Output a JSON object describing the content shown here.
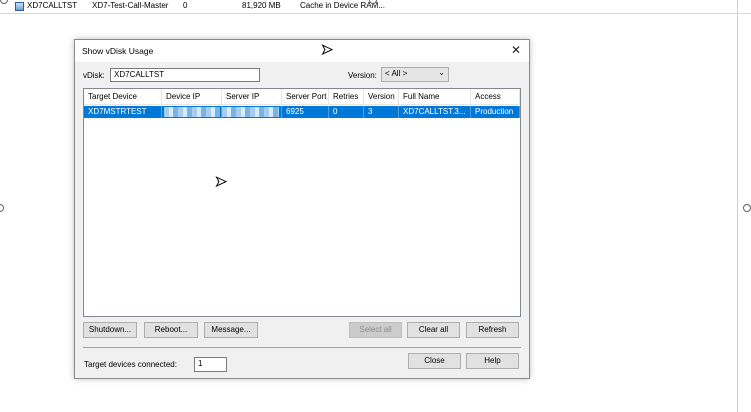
{
  "background_row": {
    "disk_name": "XD7CALLTST",
    "site": "XD7-Test-Call-Master",
    "connections": "0",
    "size": "81,920 MB",
    "cache": "Cache in Device RAM..."
  },
  "dialog": {
    "title": "Show vDisk Usage",
    "vdisk_label": "vDisk:",
    "vdisk_value": "XD7CALLTST",
    "version_label": "Version:",
    "version_value": "< All >",
    "columns": [
      "Target Device",
      "Device IP",
      "Server IP",
      "Server Port",
      "Retries",
      "Version",
      "Full Name",
      "Access"
    ],
    "rows": [
      {
        "target_device": "XD7MSTRTEST",
        "device_ip": "",
        "server_ip": "",
        "server_port": "6925",
        "retries": "0",
        "version": "3",
        "full_name": "XD7CALLTST.3...",
        "access": "Production"
      }
    ],
    "buttons": {
      "shutdown": "Shutdown...",
      "reboot": "Reboot...",
      "message": "Message...",
      "select_all": "Select all",
      "clear_all": "Clear all",
      "refresh": "Refresh",
      "close": "Close",
      "help": "Help"
    },
    "connected_label": "Target devices connected:",
    "connected_value": "1"
  },
  "icons": {
    "close": "close-icon",
    "dropdown": "chevron-down-icon",
    "disk": "vdisk-icon"
  },
  "colors": {
    "selection": "#0078d7",
    "dialog_bg": "#f0f0f0"
  }
}
